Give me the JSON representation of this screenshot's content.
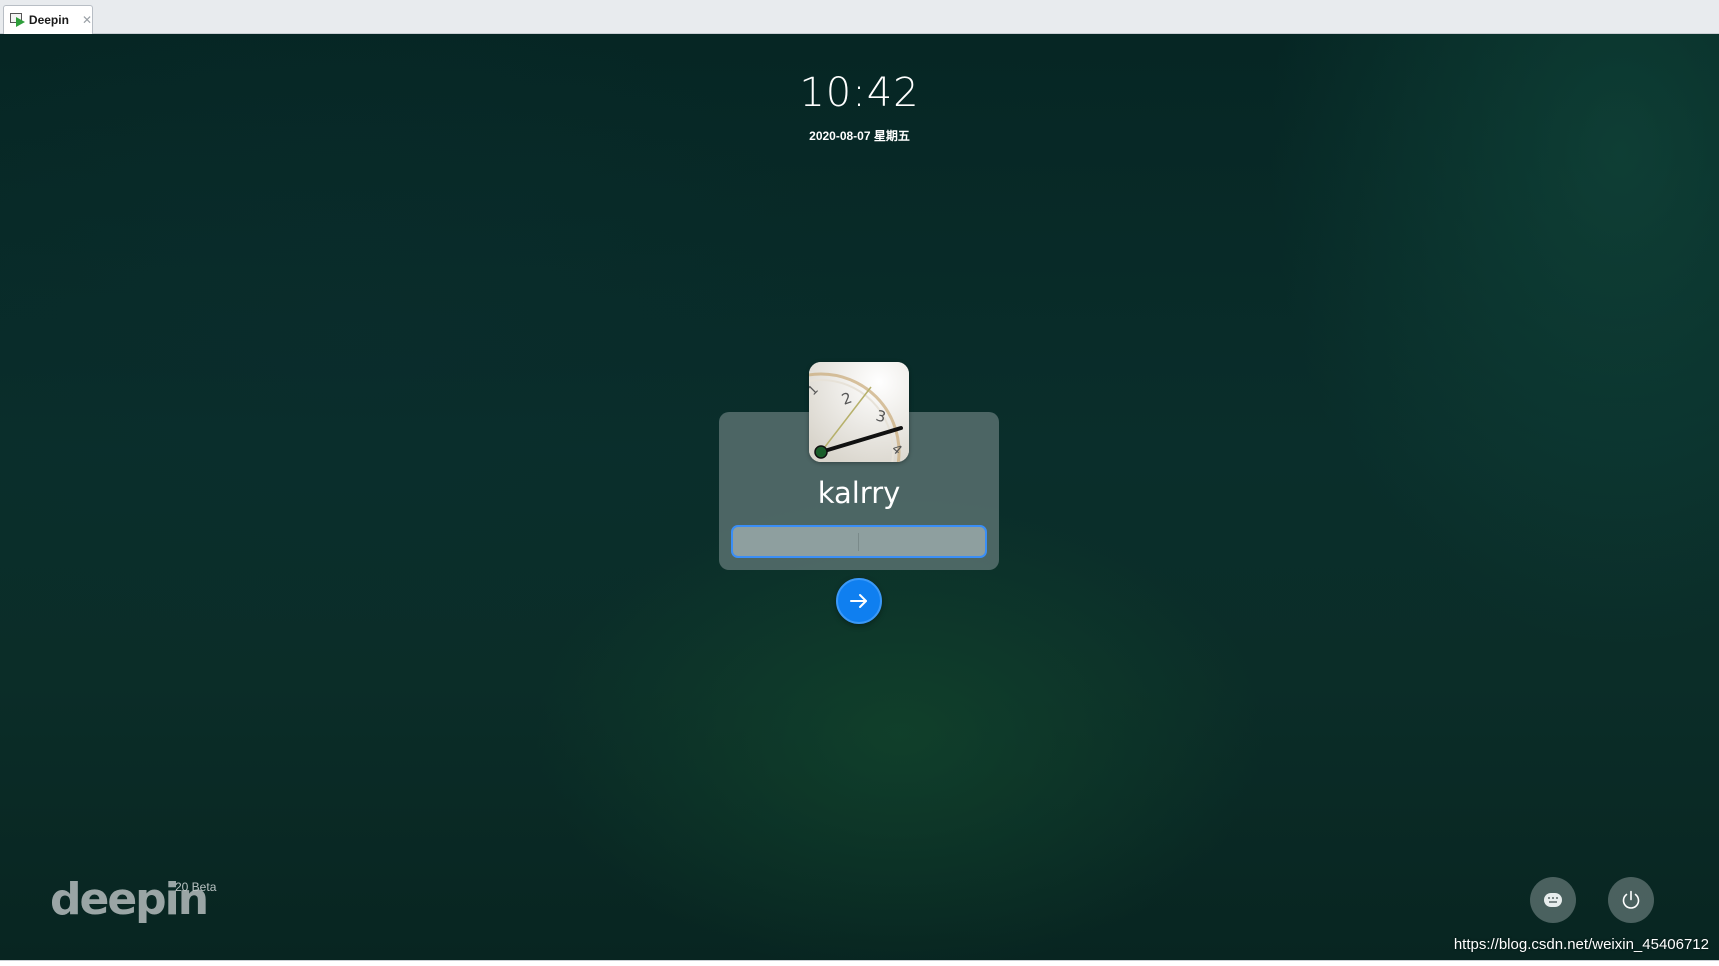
{
  "vm_tab": {
    "label": "Deepin",
    "close_glyph": "✕",
    "icon": "vm-play-icon"
  },
  "lock_screen": {
    "time": "10:42",
    "date": "2020-08-07 星期五"
  },
  "login": {
    "username": "kalrry",
    "password_value": "",
    "avatar_icon": "clock-avatar",
    "submit_icon": "arrow-right-icon"
  },
  "branding": {
    "logo_text": "deepin",
    "version": "20 Beta"
  },
  "controls": {
    "keyboard_icon": "keyboard-layout-icon",
    "power_icon": "power-icon"
  },
  "watermark": "https://blog.csdn.net/weixin_45406712",
  "colors": {
    "accent": "#0f7ff0",
    "card": "#6c8080",
    "background": "#0a2e2b"
  }
}
